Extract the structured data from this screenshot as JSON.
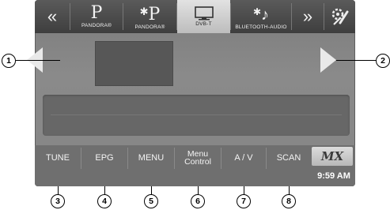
{
  "topbar": {
    "prev_glyph": "«",
    "next_glyph": "»",
    "sources": [
      {
        "label": "PANDORA®",
        "icon": "pandora-icon",
        "glyph": "P"
      },
      {
        "label": "PANDORA®",
        "icon": "bluetooth-pandora-icon",
        "glyph": "P"
      },
      {
        "label": "DVB-T",
        "icon": "tv-icon"
      },
      {
        "label": "BLUETOOTH-AUDIO",
        "icon": "bluetooth-music-icon"
      }
    ],
    "setup_icon": "setup-tools-icon"
  },
  "bottombar": {
    "tune": "TUNE",
    "epg": "EPG",
    "menu": "MENU",
    "menu_control_l1": "Menu",
    "menu_control_l2": "Control",
    "av": "A / V",
    "scan": "SCAN",
    "logo": "MX",
    "clock": "9:59 AM"
  },
  "callouts": [
    "1",
    "2",
    "3",
    "4",
    "5",
    "6",
    "7",
    "8"
  ],
  "colors": {
    "screen": "#7b7b7b",
    "selected_tab": "#d0d0d0",
    "bars": "#4a4a4a"
  }
}
